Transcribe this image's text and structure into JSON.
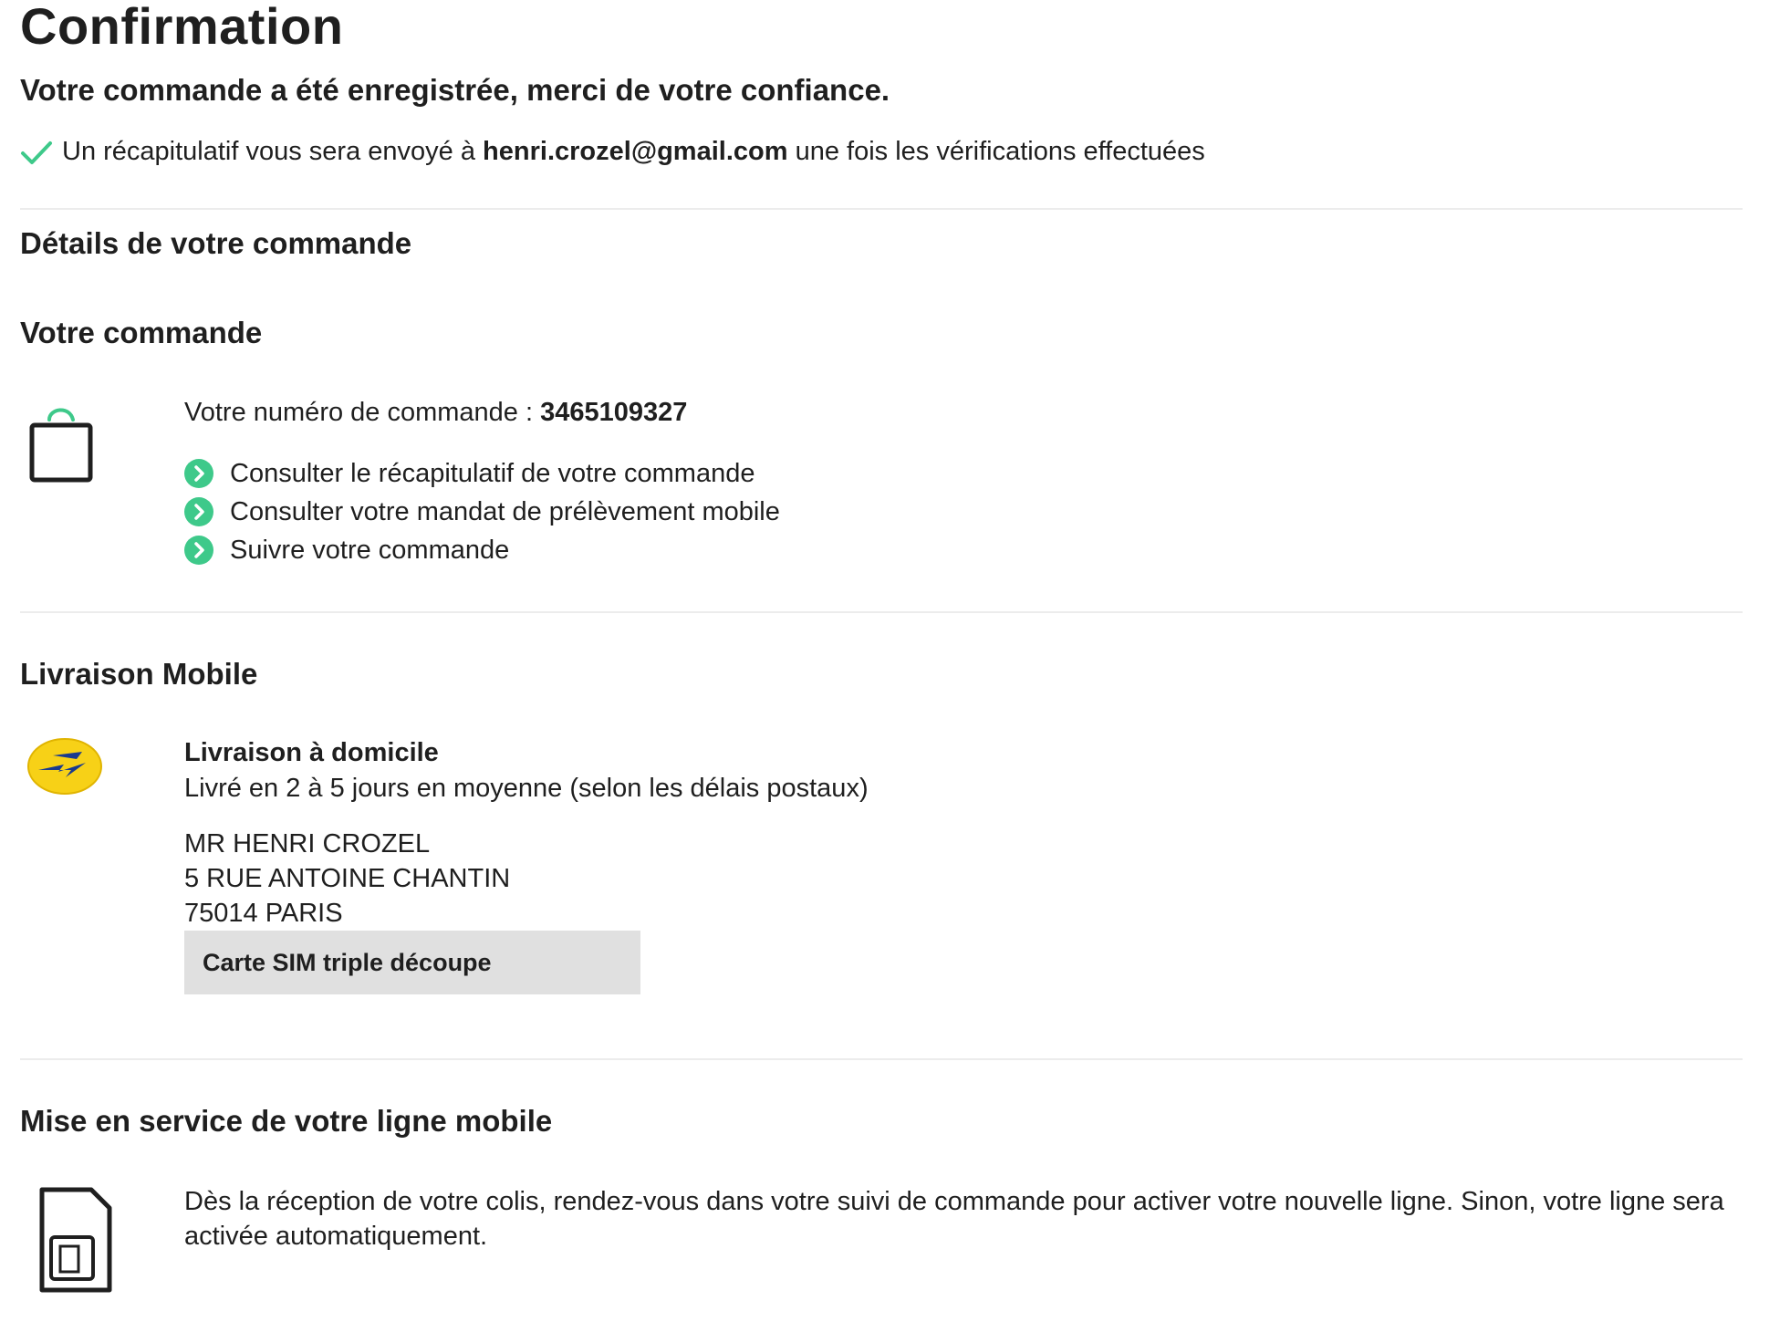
{
  "header": {
    "title": "Confirmation",
    "thanks": "Votre commande a été enregistrée, merci de votre confiance.",
    "notice_before": "Un récapitulatif vous sera envoyé à",
    "notice_email": "henri.crozel@gmail.com",
    "notice_after": "une fois les vérifications effectuées"
  },
  "details": {
    "title": "Détails de votre commande"
  },
  "order": {
    "title": "Votre commande",
    "number_label": "Votre numéro de commande :",
    "number": "3465109327",
    "links": [
      "Consulter le récapitulatif de votre commande",
      "Consulter votre mandat de prélèvement mobile",
      "Suivre votre commande"
    ]
  },
  "delivery": {
    "title": "Livraison Mobile",
    "method": "Livraison à domicile",
    "delay": "Livré en 2 à 5 jours en moyenne (selon les délais postaux)",
    "address": [
      "MR HENRI CROZEL",
      "5 RUE ANTOINE CHANTIN",
      "75014 PARIS"
    ],
    "product": "Carte SIM triple découpe"
  },
  "activation": {
    "title": "Mise en service de votre ligne mobile",
    "text": "Dès la réception de votre colis, rendez-vous dans votre suivi de commande pour activer votre nouvelle ligne. Sinon, votre ligne sera activée automatiquement."
  },
  "colors": {
    "accent_green": "#3ec98a",
    "divider": "#ececec",
    "tag_bg": "#e0e0e0",
    "laposte_yellow": "#f7d117",
    "laposte_blue": "#1a3a8f"
  },
  "icons": [
    "check-icon",
    "shopping-bag-icon",
    "chevron-right-circle-icon",
    "la-poste-logo",
    "sim-card-icon"
  ]
}
